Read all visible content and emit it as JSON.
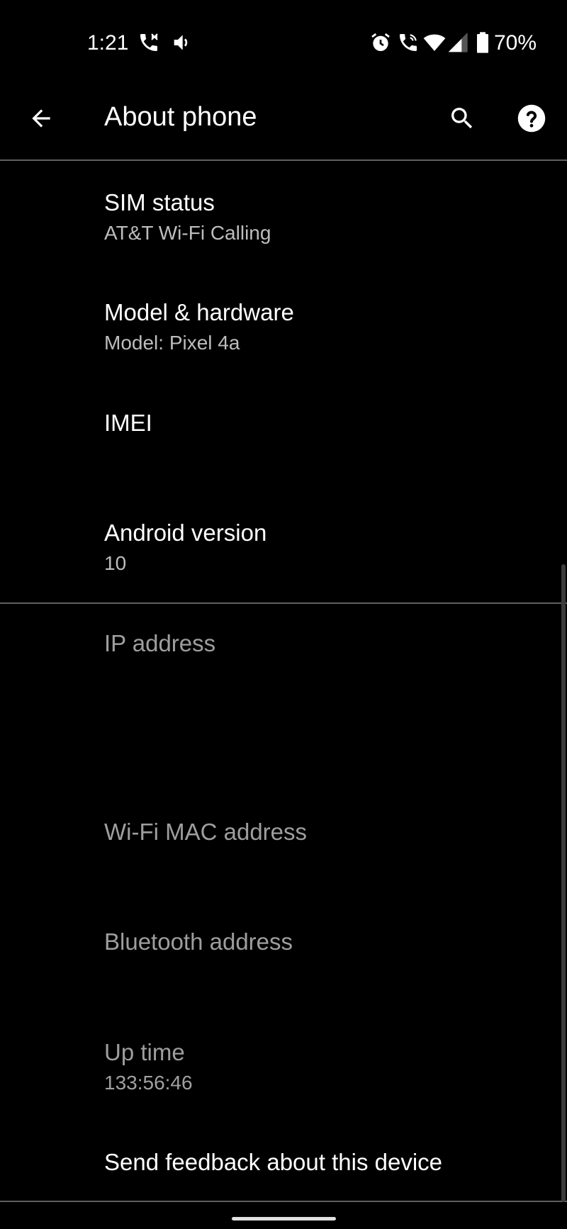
{
  "status_bar": {
    "time": "1:21",
    "battery_percent": "70%",
    "icons": [
      "call-active-icon",
      "volume-icon",
      "alarm-icon",
      "wifi-calling-icon",
      "wifi-icon",
      "cell-signal-icon",
      "battery-icon"
    ]
  },
  "toolbar": {
    "title": "About phone",
    "back_icon": "arrow-back-icon",
    "search_icon": "search-icon",
    "help_icon": "help-icon"
  },
  "items": [
    {
      "title": "SIM status",
      "summary": "AT&T Wi-Fi Calling"
    },
    {
      "title": "Model & hardware",
      "summary": "Model: Pixel 4a"
    },
    {
      "title": "IMEI",
      "summary": ""
    },
    {
      "title": "Android version",
      "summary": "10"
    },
    {
      "title": "IP address",
      "summary": ""
    },
    {
      "title": "Wi-Fi MAC address",
      "summary": ""
    },
    {
      "title": "Bluetooth address",
      "summary": ""
    },
    {
      "title": "Up time",
      "summary": "133:56:46"
    },
    {
      "title": "Send feedback about this device",
      "summary": ""
    }
  ],
  "colors": {
    "background": "#000000",
    "primary_text": "#ffffff",
    "secondary_text": "#bdbdbd",
    "disabled_text": "#9e9e9e",
    "divider": "#5f5f5f"
  }
}
